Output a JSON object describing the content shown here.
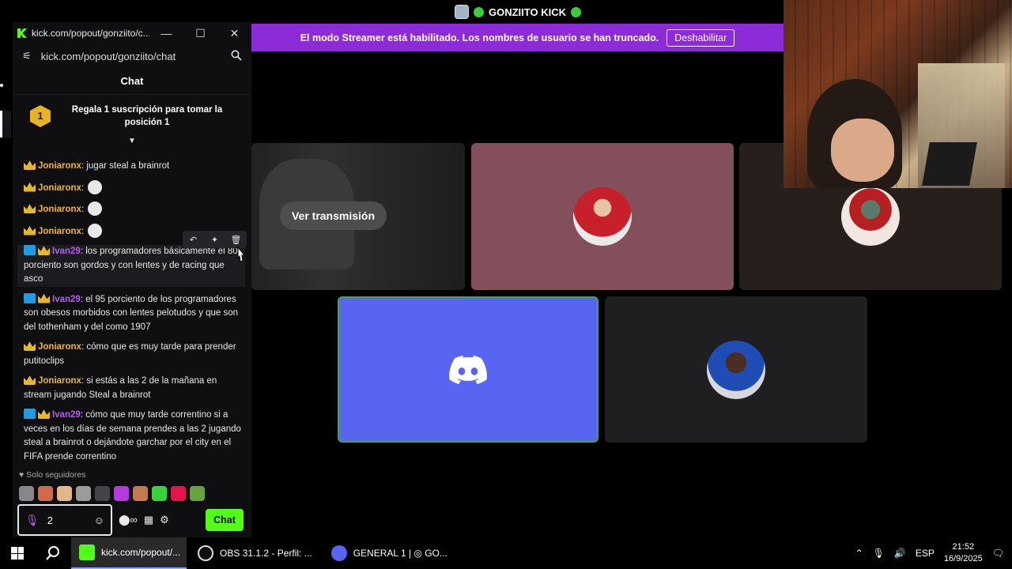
{
  "top": {
    "title": "GONZIITO KICK"
  },
  "banner": {
    "text": "El modo Streamer está habilitado. Los nombres de usuario se han truncado.",
    "button": "Deshabilitar"
  },
  "stream_tile": {
    "watch_label": "Ver transmisión"
  },
  "kick_window": {
    "title": "kick.com/popout/gonziito/c...",
    "url": "kick.com/popout/gonziito/chat",
    "chat_header": "Chat",
    "promo_rank": "1",
    "promo_text": "Regala 1 suscripción para tomar la posición 1"
  },
  "messages": [
    {
      "user": "Joniaronx",
      "text": "jugar steal a brainrot",
      "badges": [
        "crown"
      ],
      "emote": false
    },
    {
      "user": "Joniaronx",
      "text": "",
      "badges": [
        "crown"
      ],
      "emote": true
    },
    {
      "user": "Joniaronx",
      "text": "",
      "badges": [
        "crown"
      ],
      "emote": true
    },
    {
      "user": "Joniaronx",
      "text": "",
      "badges": [
        "crown"
      ],
      "emote": true
    },
    {
      "user": "Ivan29",
      "text": "los programadores básicamente el 80 porciento son gordos y con lentes y de racing que asco",
      "badges": [
        "vip",
        "crown"
      ],
      "emote": false
    },
    {
      "user": "Ivan29",
      "text": "el 95 porciento de los programadores son obesos morbidos con lentes pelotudos y que son del tothenham y del como 1907",
      "badges": [
        "vip",
        "crown"
      ],
      "emote": false
    },
    {
      "user": "Joniaronx",
      "text": "cómo que es muy tarde para prender putitoclips",
      "badges": [
        "crown"
      ],
      "emote": false
    },
    {
      "user": "Joniaronx",
      "text": "si estás a las 2 de la mañana en stream jugando Steal a brainrot",
      "badges": [
        "crown"
      ],
      "emote": false
    },
    {
      "user": "Ivan29",
      "text": "cómo que muy tarde correntino si a veces en los días de semana prendes a las 2 jugando steal a brainrot o dejándote garchar por el city en el FIFA prende correntino",
      "badges": [
        "vip",
        "crown"
      ],
      "emote": false
    }
  ],
  "footer": {
    "followers_only": "Solo seguidores",
    "viewers": "2",
    "chat_button": "Chat"
  },
  "taskbar": {
    "items": [
      "kick.com/popout/...",
      "OBS 31.1.2 - Perfil: ...",
      "GENERAL 1 | ◎ GO..."
    ],
    "lang": "ESP",
    "time": "21:52",
    "date": "16/9/2025"
  },
  "colors": {
    "kick_green": "#53fc18",
    "banner_purple": "#8e2bd9",
    "discord_blurple": "#5865f2",
    "joniaronx": "#f1b629",
    "ivan29": "#b65cf2"
  }
}
